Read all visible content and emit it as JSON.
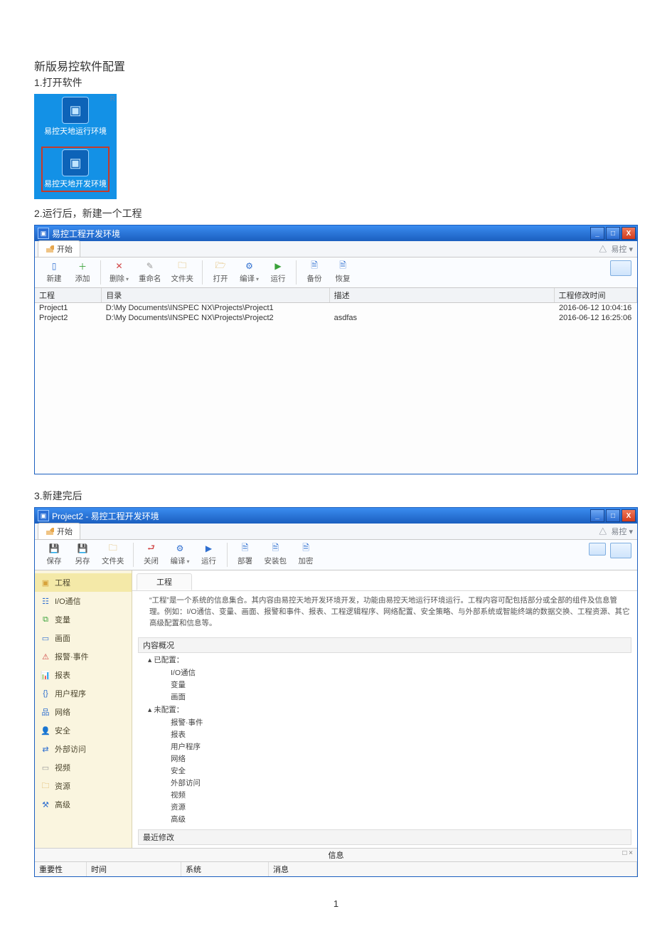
{
  "doc": {
    "title": "新版易控软件配置",
    "page_number": "1"
  },
  "steps": {
    "s1": "1.打开软件",
    "s2": "2.运行后，新建一个工程",
    "s3": "3.新建完后"
  },
  "desktop": {
    "icon_runtime": "易控天地运行环境",
    "icon_dev": "易控天地开发环境",
    "corner": "R"
  },
  "win_common": {
    "min": "_",
    "max": "□",
    "close": "X",
    "start_tab": "开始",
    "right_link": "易控 ▾",
    "right_tri": "△"
  },
  "win1": {
    "title": "易控工程开发环境",
    "toolbar": {
      "new": "新建",
      "add": "添加",
      "delete": "删除",
      "rename": "重命名",
      "folder": "文件夹",
      "open": "打开",
      "compile": "编译",
      "run": "运行",
      "backup": "备份",
      "restore": "恢复"
    },
    "headers": {
      "project": "工程",
      "dir": "目录",
      "desc": "描述",
      "time": "工程修改时间"
    },
    "rows": [
      {
        "project": "Project1",
        "dir": "D:\\My Documents\\INSPEC NX\\Projects\\Project1",
        "desc": "",
        "time": "2016-06-12 10:04:16"
      },
      {
        "project": "Project2",
        "dir": "D:\\My Documents\\INSPEC NX\\Projects\\Project2",
        "desc": "asdfas",
        "time": "2016-06-12 16:25:06"
      }
    ]
  },
  "win2": {
    "title": "Project2 - 易控工程开发环境",
    "toolbar": {
      "save": "保存",
      "saveas": "另存",
      "folder": "文件夹",
      "close": "关闭",
      "compile": "编译",
      "run": "运行",
      "deploy": "部署",
      "installer": "安装包",
      "encrypt": "加密"
    },
    "sidebar": [
      "工程",
      "I/O通信",
      "变量",
      "画面",
      "报警·事件",
      "报表",
      "用户程序",
      "网络",
      "安全",
      "外部访问",
      "视频",
      "资源",
      "高级"
    ],
    "main": {
      "crumb": "工程",
      "desc": "“工程”是一个系统的信息集合。其内容由易控天地开发环境开发，功能由易控天地运行环境运行。工程内容可配包括部分或全部的组件及信息管理。例如：I/O通信、变量、画面、报警和事件、报表、工程逻辑程序、网络配置、安全策略、与外部系统或智能终端的数据交换、工程资源、其它高级配置和信息等。",
      "overview": "内容概况",
      "configured": "已配置：",
      "configured_items": [
        "I/O通信",
        "变量",
        "画面"
      ],
      "unconfigured": "未配置：",
      "unconfigured_items": [
        "报警·事件",
        "报表",
        "用户程序",
        "网络",
        "安全",
        "外部访问",
        "视频",
        "资源",
        "高级"
      ],
      "recent": "最近修改"
    },
    "info": {
      "label": "信息",
      "severity": "重要性",
      "time": "时间",
      "system": "系统",
      "message": "消息",
      "pin": "□ ×"
    }
  }
}
